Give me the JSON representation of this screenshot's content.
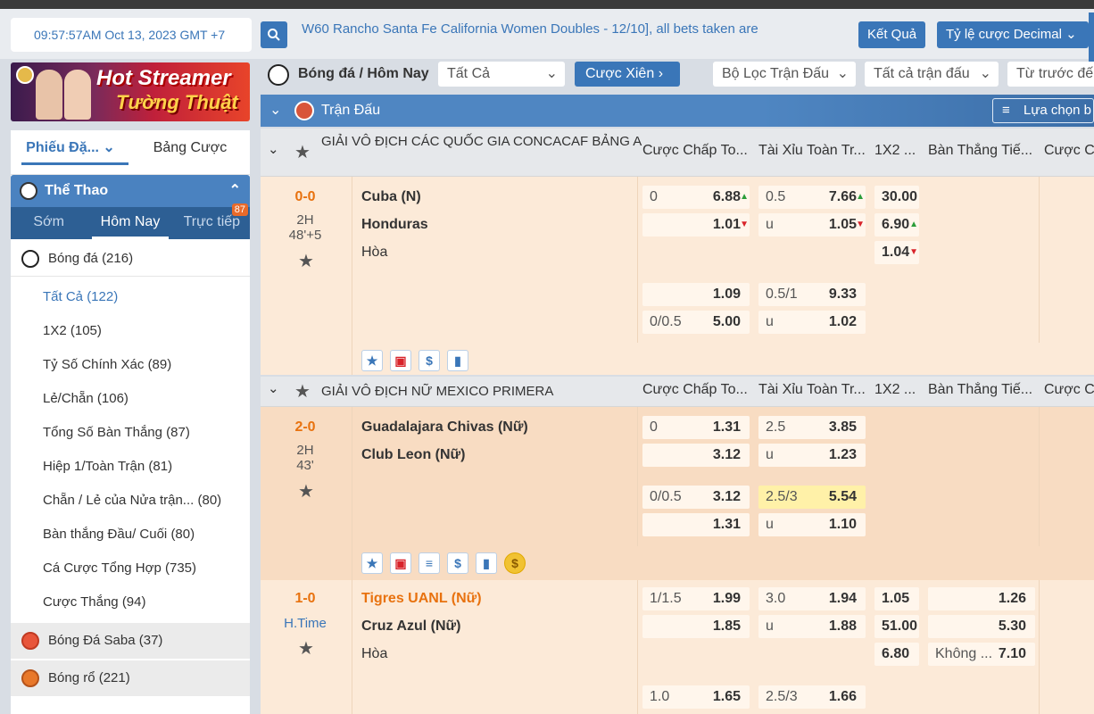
{
  "header": {
    "clock": "09:57:57AM Oct 13, 2023 GMT +7",
    "ticker": "W60 Rancho Santa Fe California Women Doubles - 12/10], all bets taken are",
    "results_label": "Kết Quả",
    "odds_label": "Tỷ lệ cược Decimal"
  },
  "banner": {
    "line1": "Hot Streamer",
    "line2": "Tường Thuật"
  },
  "sidebar": {
    "tabs": [
      "Phiếu Đặ...",
      "Bảng Cược"
    ],
    "sports_title": "Thể Thao",
    "periods": [
      "Sớm",
      "Hôm Nay",
      "Trực tiếp"
    ],
    "live_count": "87",
    "football": {
      "label": "Bóng đá",
      "count": "(216)"
    },
    "items": [
      {
        "label": "Tất Cả",
        "count": "(122)"
      },
      {
        "label": "1X2",
        "count": "(105)"
      },
      {
        "label": "Tỷ Số Chính Xác",
        "count": "(89)"
      },
      {
        "label": "Lẻ/Chẵn",
        "count": "(106)"
      },
      {
        "label": "Tổng Số Bàn Thắng",
        "count": "(87)"
      },
      {
        "label": "Hiệp 1/Toàn Trận",
        "count": "(81)"
      },
      {
        "label": "Chẵn / Lẻ của Nửa trận...",
        "count": "(80)"
      },
      {
        "label": "Bàn thắng Đầu/ Cuối",
        "count": "(80)"
      },
      {
        "label": "Cá Cược Tổng Hợp",
        "count": "(735)"
      },
      {
        "label": "Cược Thắng",
        "count": "(94)"
      }
    ],
    "saba": {
      "label": "Bóng Đá Saba",
      "count": "(37)"
    },
    "basketball": {
      "label": "Bóng rổ",
      "count": "(221)"
    }
  },
  "toolbar": {
    "breadcrumb": "Bóng đá / Hôm Nay",
    "filter_all": "Tất Cả",
    "parlay": "Cược Xiên",
    "match_filter": "Bộ Lọc Trận Đấu",
    "all_matches": "Tất cả trận đấu",
    "sort": "Từ trước đế"
  },
  "section": {
    "title": "Trận Đấu",
    "pick": "Lựa chọn b"
  },
  "columns": [
    "Cược Chấp To...",
    "Tài Xỉu Toàn Tr...",
    "1X2 ...",
    "Bàn Thắng Tiế...",
    "Cược Ch"
  ],
  "leagues": [
    {
      "name": "GIẢI VÔ ĐỊCH CÁC QUỐC GIA CONCACAF BẢNG A",
      "match": {
        "score": "0-0",
        "period": "2H",
        "time": "48'+5",
        "home": "Cuba (N)",
        "away": "Honduras",
        "draw": "Hòa",
        "hdp": [
          [
            "0",
            "6.88"
          ],
          [
            "",
            "1.01"
          ],
          [
            "1.09",
            ""
          ],
          [
            "0/0.5",
            "5.00"
          ]
        ],
        "ou": [
          [
            "0.5",
            "7.66"
          ],
          [
            "u",
            "1.05"
          ],
          [
            "0.5/1",
            "9.33"
          ],
          [
            "u",
            "1.02"
          ]
        ],
        "x12": [
          "30.00",
          "6.90",
          "1.04"
        ]
      }
    },
    {
      "name": "GIẢI VÔ ĐỊCH NỮ MEXICO PRIMERA",
      "match": {
        "score": "2-0",
        "period": "2H",
        "time": "43'",
        "home": "Guadalajara Chivas (Nữ)",
        "away": "Club Leon (Nữ)",
        "hdp": [
          [
            "0",
            "1.31"
          ],
          [
            "",
            "3.12"
          ],
          [
            "0/0.5",
            "3.12"
          ],
          [
            "",
            "1.31"
          ]
        ],
        "ou": [
          [
            "2.5",
            "3.85"
          ],
          [
            "u",
            "1.23"
          ],
          [
            "2.5/3",
            "5.54"
          ],
          [
            "u",
            "1.10"
          ]
        ]
      },
      "match2": {
        "score": "1-0",
        "period": "H.Time",
        "home": "Tigres UANL (Nữ)",
        "away": "Cruz Azul (Nữ)",
        "draw": "Hòa",
        "hdp": [
          [
            "1/1.5",
            "1.99"
          ],
          [
            "",
            "1.85"
          ],
          [
            "1.0",
            "1.65"
          ]
        ],
        "ou": [
          [
            "3.0",
            "1.94"
          ],
          [
            "u",
            "1.88"
          ],
          [
            "2.5/3",
            "1.66"
          ]
        ],
        "x12": [
          "1.05",
          "51.00",
          "6.80"
        ],
        "next_goal": [
          [
            "",
            "1.26"
          ],
          [
            "",
            "5.30"
          ],
          [
            "Không ...",
            "7.10"
          ]
        ]
      }
    }
  ]
}
